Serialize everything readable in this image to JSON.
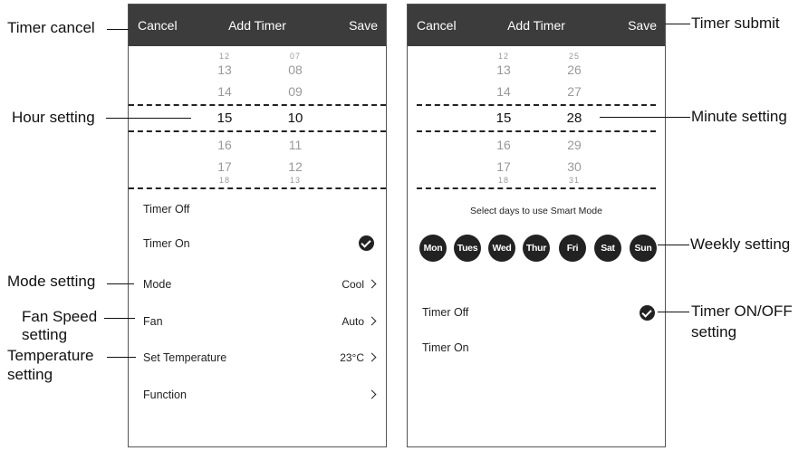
{
  "left_screen": {
    "header": {
      "cancel": "Cancel",
      "title": "Add Timer",
      "save": "Save"
    },
    "picker": {
      "hours": [
        "12",
        "13",
        "14",
        "15",
        "16",
        "17",
        "18"
      ],
      "minutes": [
        "07",
        "08",
        "09",
        "10",
        "11",
        "12",
        "13"
      ],
      "selected_hour": "15",
      "selected_minute": "10"
    },
    "timer_off": "Timer Off",
    "timer_on": "Timer On",
    "timer_on_checked": true,
    "settings": [
      {
        "label": "Mode",
        "value": "Cool"
      },
      {
        "label": "Fan",
        "value": "Auto"
      },
      {
        "label": "Set Temperature",
        "value": "23°C"
      },
      {
        "label": "Function",
        "value": ""
      }
    ]
  },
  "right_screen": {
    "header": {
      "cancel": "Cancel",
      "title": "Add Timer",
      "save": "Save"
    },
    "picker": {
      "hours": [
        "12",
        "13",
        "14",
        "15",
        "16",
        "17",
        "18"
      ],
      "minutes": [
        "25",
        "26",
        "27",
        "28",
        "29",
        "30",
        "31"
      ],
      "selected_hour": "15",
      "selected_minute": "28"
    },
    "mode_hint": "Select days to use Smart Mode",
    "days": [
      "Mon",
      "Tues",
      "Wed",
      "Thur",
      "Fri",
      "Sat",
      "Sun"
    ],
    "timer_off": "Timer Off",
    "timer_on": "Timer On",
    "timer_off_checked": true
  },
  "callouts": {
    "timer_cancel": "Timer cancel",
    "hour_setting": "Hour setting",
    "mode_setting": "Mode setting",
    "fan_speed_line1": "Fan Speed",
    "fan_speed_line2": "setting",
    "temperature_line1": "Temperature",
    "temperature_line2": "setting",
    "timer_submit": "Timer submit",
    "minute_setting": "Minute setting",
    "weekly_setting": "Weekly setting",
    "timer_onoff_line1": "Timer ON/OFF",
    "timer_onoff_line2": "setting"
  },
  "colors": {
    "header_bg": "#3c3c3c",
    "day_bg": "#222222",
    "text": "#222222"
  }
}
